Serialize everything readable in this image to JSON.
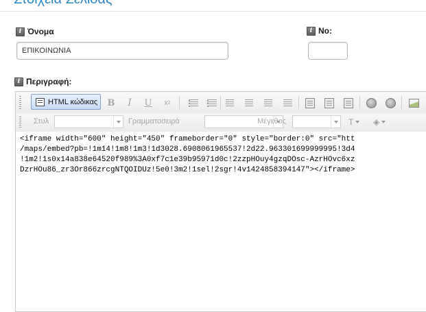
{
  "page": {
    "title": "Στοιχεία Σελίδας"
  },
  "fields": {
    "name": {
      "label": "Όνομα",
      "value": "ΕΠΙΚΟΙΝΩΝΙΑ"
    },
    "number": {
      "label": "Νο:",
      "value": ""
    },
    "description": {
      "label": "Περιγραφή:"
    }
  },
  "editor": {
    "toolbar": {
      "source_label": "HTML κώδικας",
      "style_label": "Στυλ",
      "font_label": "Γραμματοσειρά",
      "size_label": "Μέγεθος",
      "icons": [
        "bold-icon",
        "italic-icon",
        "underline-icon",
        "superscript-icon",
        "numbered-list-icon",
        "bulleted-list-icon",
        "align-left-icon",
        "align-center-icon",
        "align-right-icon",
        "justify-icon",
        "paste-icon",
        "paste-text-icon",
        "paste-word-icon",
        "link-icon",
        "unlink-icon",
        "image-icon",
        "text-color-icon",
        "background-color-icon"
      ]
    },
    "content_lines": [
      "<iframe width=\"600\" height=\"450\" frameborder=\"0\" style=\"border:0\" src=\"htt",
      "/maps/embed?pb=!1m14!1m8!1m3!1d3028.6908061965537!2d22.963301699999995!3d4",
      "!1m2!1s0x14a838e64520f989%3A0xf7c1e39b95971d0c!2zzpHOuy4gzqDOsc-AzrHOvc6xz",
      "DzrHOu86_zr3Or866zrcgNTQOIDUz!5e0!3m2!1sel!2sgr!4v1424858394147\"></iframe>"
    ]
  }
}
